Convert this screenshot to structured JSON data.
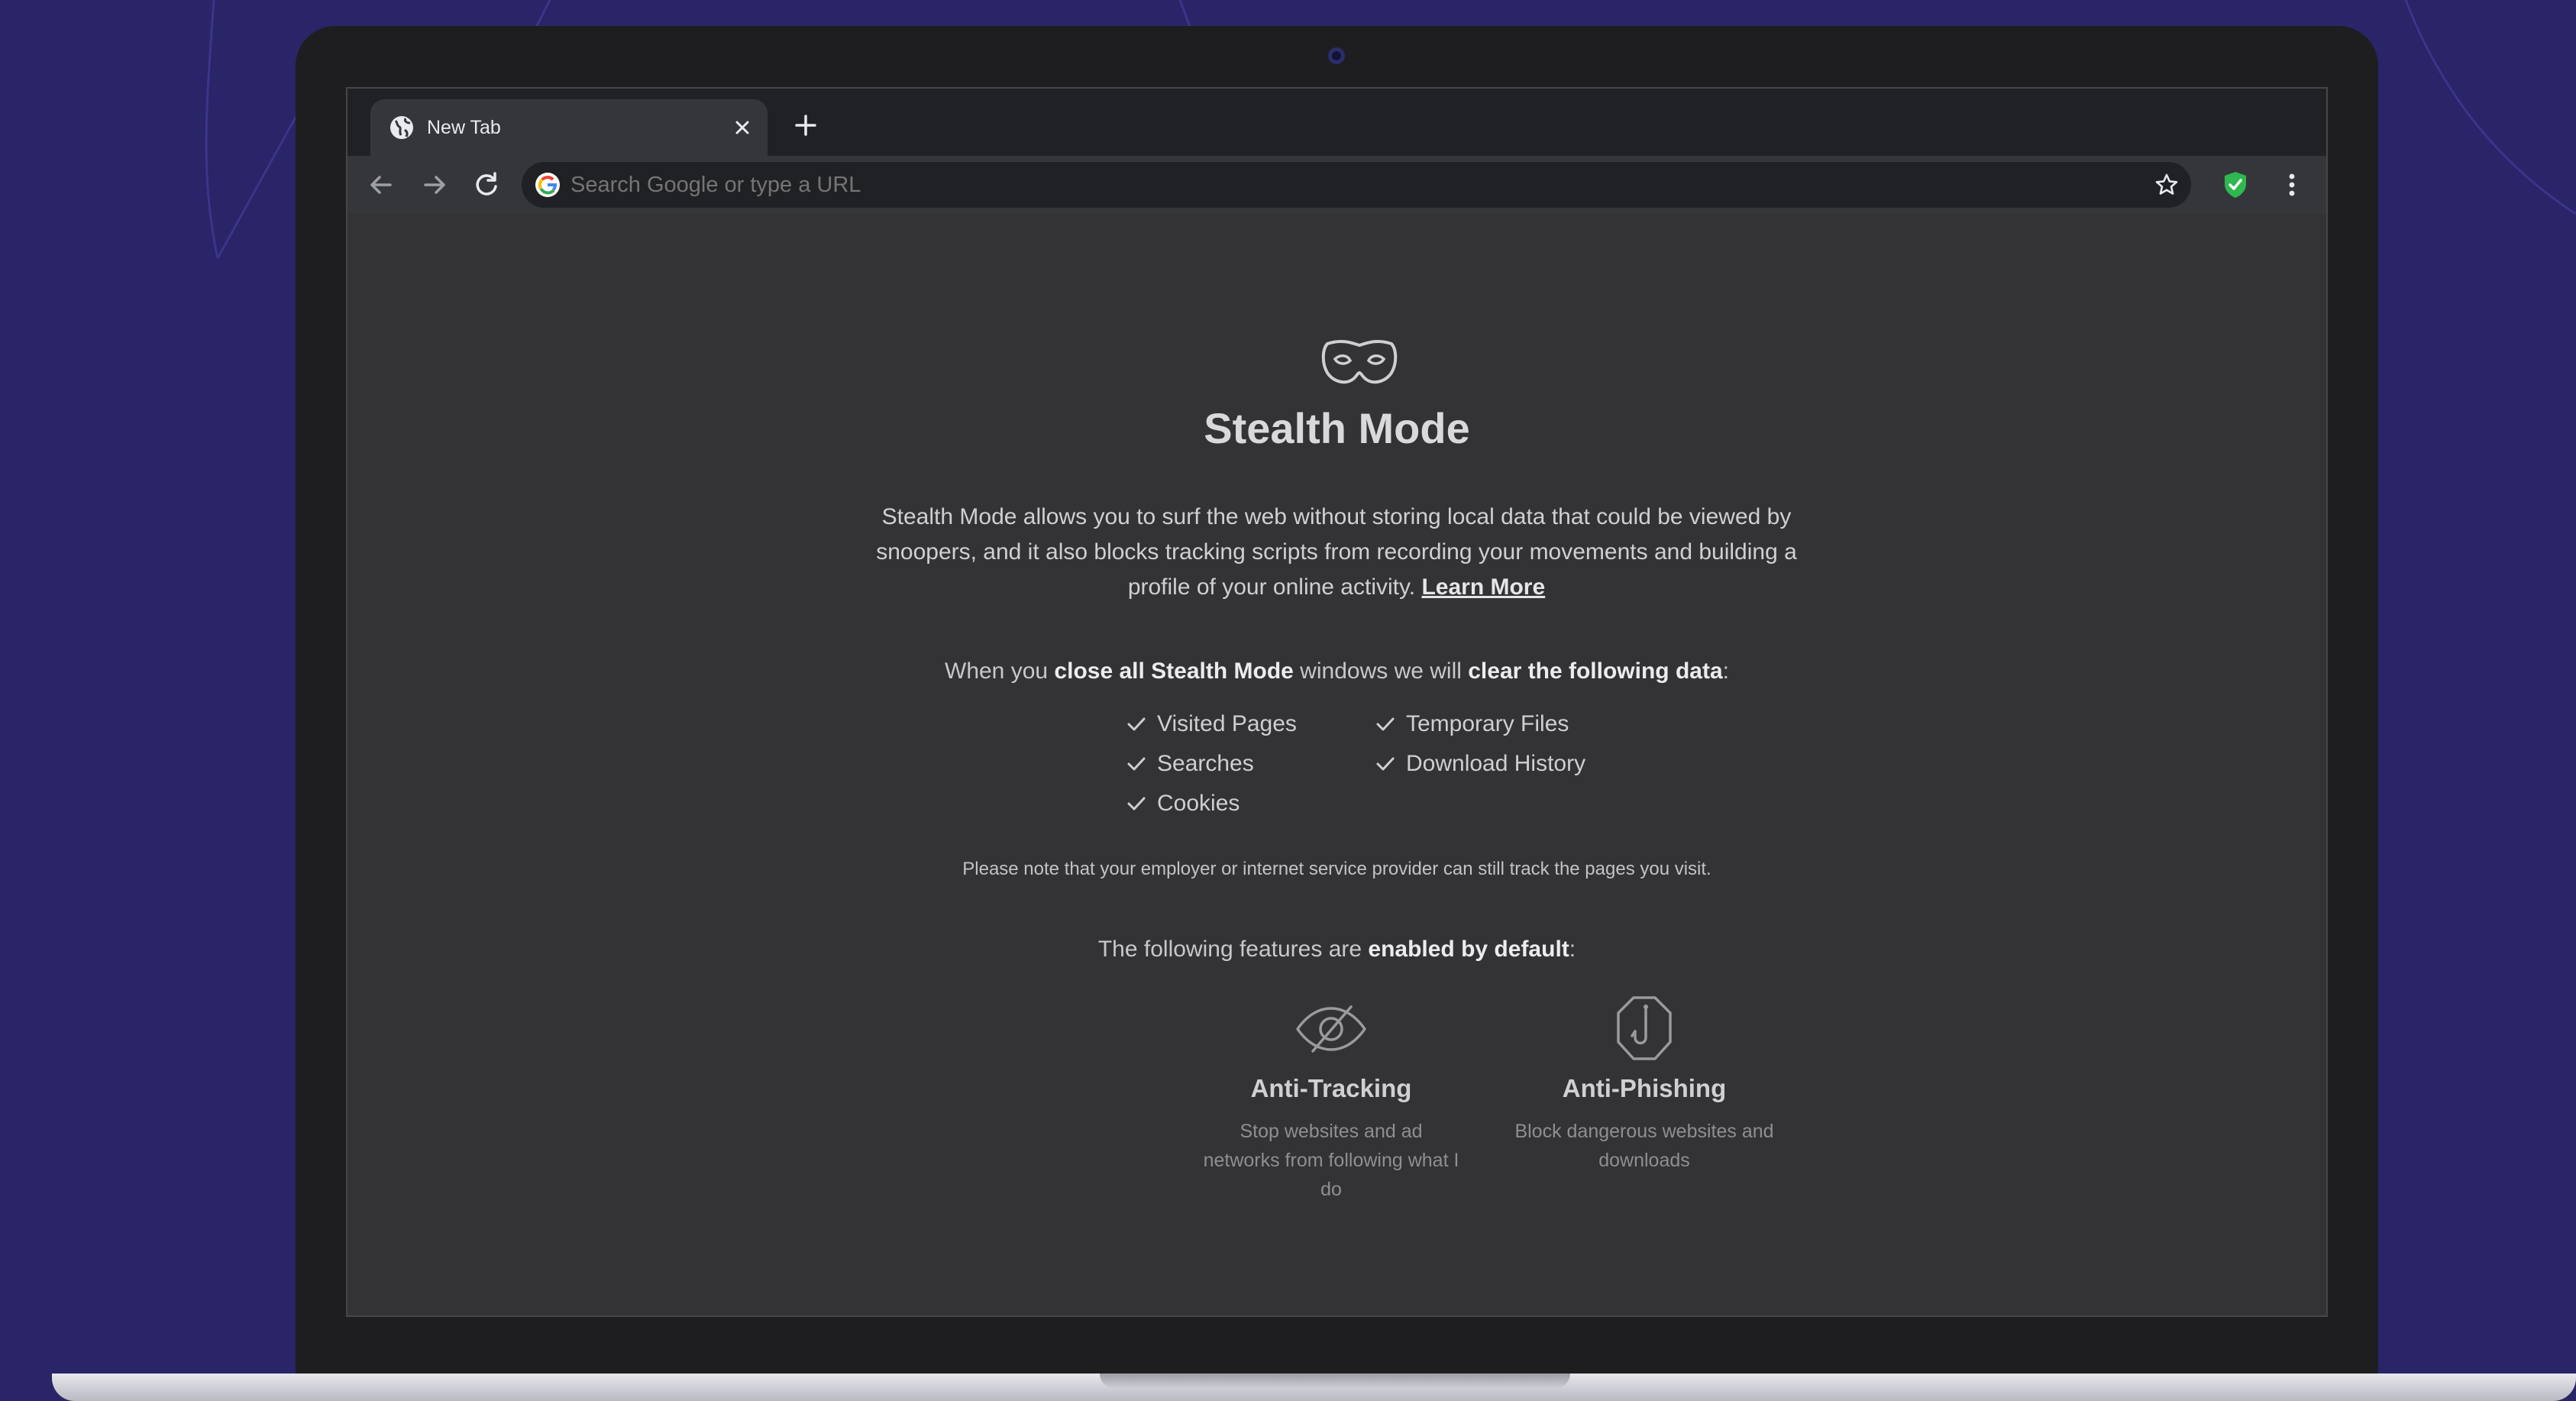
{
  "browser": {
    "tab": {
      "title": "New Tab"
    },
    "omnibox": {
      "placeholder": "Search Google or type a URL"
    }
  },
  "page": {
    "title": "Stealth Mode",
    "description": "Stealth Mode allows you to surf the web without storing local data that could be viewed by snoopers, and it also blocks tracking scripts from recording your movements and building a profile of your online activity.",
    "learn_more": "Learn More",
    "clear_line": {
      "p1": "When you ",
      "b1": "close all Stealth Mode",
      "p2": " windows we will ",
      "b2": "clear the following data",
      "p3": ":"
    },
    "cleared_data": [
      "Visited Pages",
      "Searches",
      "Cookies",
      "Temporary Files",
      "Download History"
    ],
    "note": "Please note that your employer or internet service provider can still track the pages you visit.",
    "features_line": {
      "p1": "The following features are ",
      "b1": "enabled by default",
      "p2": ":"
    },
    "features": [
      {
        "name": "Anti-Tracking",
        "description": "Stop websites and ad networks from following what I do"
      },
      {
        "name": "Anti-Phishing",
        "description": "Block dangerous websites and downloads"
      }
    ]
  },
  "icons": {
    "tab": "globe-icon",
    "close": "close-icon",
    "new_tab": "plus-icon",
    "back": "arrow-left-icon",
    "forward": "arrow-right-icon",
    "reload": "reload-icon",
    "search_engine": "google-g-icon",
    "bookmark": "star-icon",
    "extension": "shield-check-icon",
    "menu": "kebab-menu-icon",
    "hero": "mask-icon",
    "check": "checkmark-icon",
    "anti_tracking": "eye-slash-icon",
    "anti_phishing": "hook-icon"
  },
  "colors": {
    "background": "#2a2468",
    "page": "#333335",
    "tabstrip": "#202124",
    "extension_badge": "#2fb84f"
  }
}
